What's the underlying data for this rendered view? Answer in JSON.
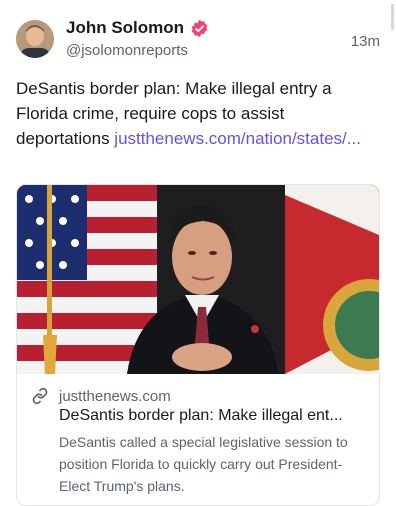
{
  "post": {
    "author_name": "John Solomon",
    "author_handle": "@jsolomonreports",
    "time_ago": "13m",
    "text_plain": "DeSantis border plan: Make illegal entry a Florida crime, require cops to assist deportations ",
    "text_link": "justthenews.com/nation/states/..."
  },
  "link_card": {
    "domain": "justthenews.com",
    "title": "DeSantis border plan: Make illegal ent...",
    "description": "DeSantis called a special legislative session to position Florida to quickly carry out President-Elect Trump's plans."
  },
  "icons": {
    "verified": "verified-badge-icon",
    "link": "link-icon"
  },
  "colors": {
    "link": "#6b4fe3",
    "verified_badge": "#f2436f",
    "secondary_text": "#5b6370"
  }
}
